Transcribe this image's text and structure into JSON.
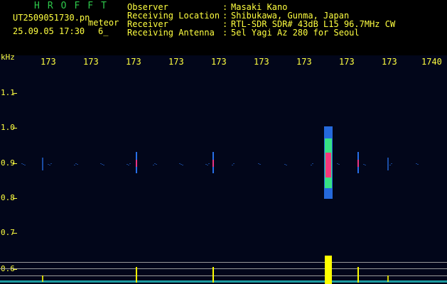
{
  "header": {
    "app_title": "HROFFT",
    "file_name": "UT2509051730.png",
    "meteor_label": "meteor",
    "datetime": "25.09.05 17:30",
    "extra": "6_",
    "meta": [
      {
        "key": "Observer",
        "value": "Masaki Kano"
      },
      {
        "key": "Receiving Location",
        "value": "Shibukawa, Gunma, Japan"
      },
      {
        "key": "Receiver",
        "value": "RTL-SDR SDR# 43dB L15 96.7MHz CW"
      },
      {
        "key": "Receiving Antenna",
        "value": "5el Yagi Az 280 for Seoul"
      }
    ],
    "separator": ":"
  },
  "axes": {
    "y_unit": "kHz",
    "x_ticks": [
      "173",
      "173",
      "173",
      "173",
      "173",
      "173",
      "173",
      "173",
      "173",
      "1740"
    ],
    "y_ticks": [
      "1.1",
      "1.0",
      "0.9",
      "0.8",
      "0.7",
      "0.6"
    ]
  },
  "colors": {
    "text": "#ffff40",
    "title": "#2ec84a",
    "background": "#02061a",
    "signal_hot": "#ff2d7a",
    "signal_warm": "#3af07a",
    "signal_cool": "#2b7bff",
    "spectrum": "#ffff00"
  },
  "signals": [
    {
      "x_index": 0.5,
      "kind": "weak"
    },
    {
      "x_index": 2.7,
      "kind": "trace"
    },
    {
      "x_index": 4.5,
      "kind": "trace"
    },
    {
      "x_index": 7.2,
      "kind": "meteor"
    },
    {
      "x_index": 7.9,
      "kind": "trace"
    },
    {
      "x_index": 8.6,
      "kind": "weak"
    }
  ]
}
